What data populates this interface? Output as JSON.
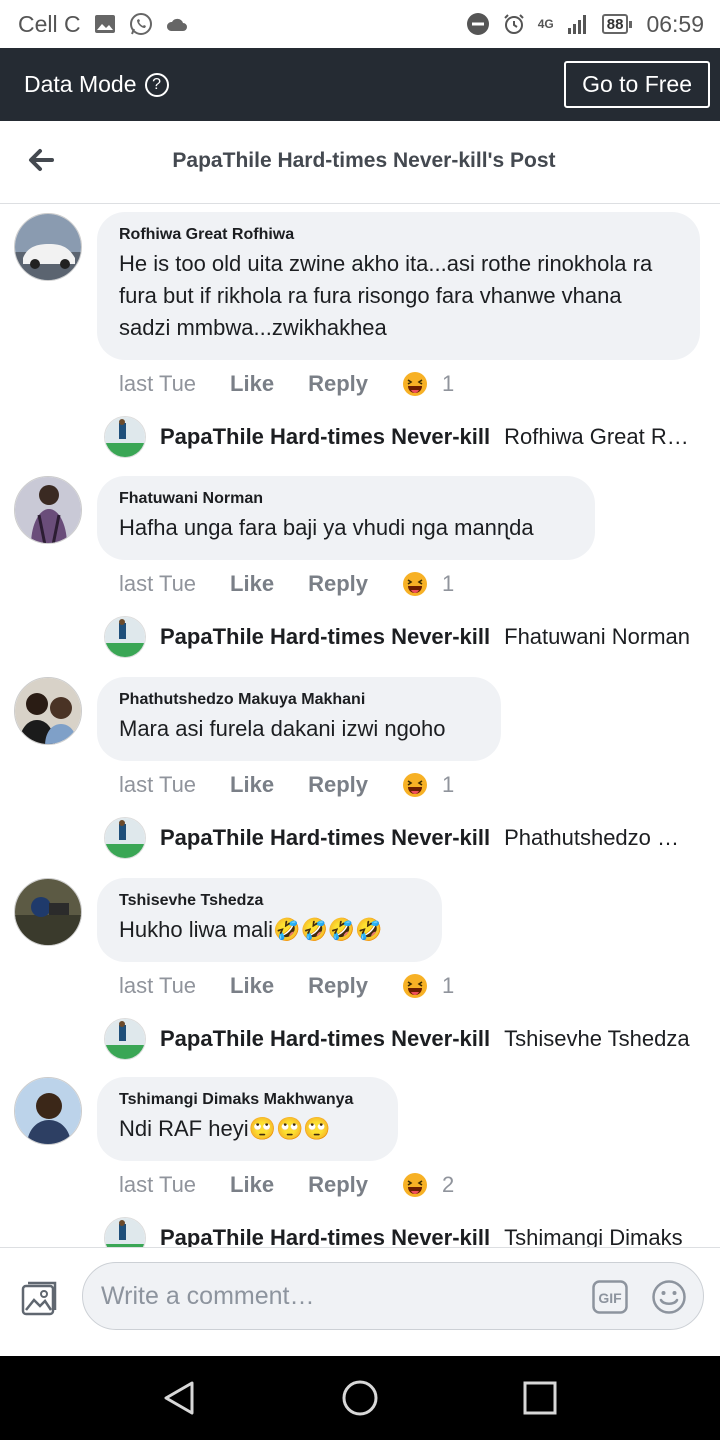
{
  "status_bar": {
    "carrier": "Cell C",
    "network": "4G",
    "battery": "88",
    "time": "06:59"
  },
  "data_bar": {
    "label": "Data Mode",
    "help_icon": "?",
    "free_button": "Go to Free"
  },
  "header": {
    "title": "PapaThile Hard-times Never-kill's Post"
  },
  "comments": [
    {
      "author": "Rofhiwa Great Rofhiwa",
      "text": "He is too old uita zwine akho ita...asi rothe rinokhola ra fura but if rikhola ra fura risongo fara vhanwe vhana sadzi mmbwa...zwikhakhea",
      "time": "last Tue",
      "like": "Like",
      "reply": "Reply",
      "reaction_count": "1",
      "reply_author": "PapaThile Hard-times Never-kill",
      "reply_snippet": "Rofhiwa Great Rofhiwa"
    },
    {
      "author": "Fhatuwani Norman",
      "text": "Hafha unga fara baji ya vhudi nga manɳda",
      "time": "last Tue",
      "like": "Like",
      "reply": "Reply",
      "reaction_count": "1",
      "reply_author": "PapaThile Hard-times Never-kill",
      "reply_snippet": "Fhatuwani Norman"
    },
    {
      "author": "Phathutshedzo Makuya Makhani",
      "text": "Mara asi furela dakani izwi ngoho",
      "time": "last Tue",
      "like": "Like",
      "reply": "Reply",
      "reaction_count": "1",
      "reply_author": "PapaThile Hard-times Never-kill",
      "reply_snippet": "Phathutshedzo Makuya"
    },
    {
      "author": "Tshisevhe Tshedza",
      "text": "Hukho liwa mali🤣🤣🤣🤣",
      "time": "last Tue",
      "like": "Like",
      "reply": "Reply",
      "reaction_count": "1",
      "reply_author": "PapaThile Hard-times Never-kill",
      "reply_snippet": "Tshisevhe Tshedza"
    },
    {
      "author": "Tshimangi Dimaks Makhwanya",
      "text": "Ndi RAF heyi🙄🙄🙄",
      "time": "last Tue",
      "like": "Like",
      "reply": "Reply",
      "reaction_count": "2",
      "reply_author": "PapaThile Hard-times Never-kill",
      "reply_snippet": "Tshimangi Dimaks"
    }
  ],
  "composer": {
    "placeholder": "Write a comment…",
    "gif_label": "GIF"
  },
  "colors": {
    "data_bar_bg": "#252b33",
    "bubble_bg": "#f0f2f5",
    "nav_bar_bg": "#000000"
  },
  "icons": {
    "back": "arrow-left-icon",
    "reaction": "laughing-face-icon",
    "photo": "photo-icon",
    "emoji": "smiley-icon",
    "nav_back": "triangle-back-icon",
    "nav_home": "circle-home-icon",
    "nav_recents": "square-recents-icon"
  }
}
